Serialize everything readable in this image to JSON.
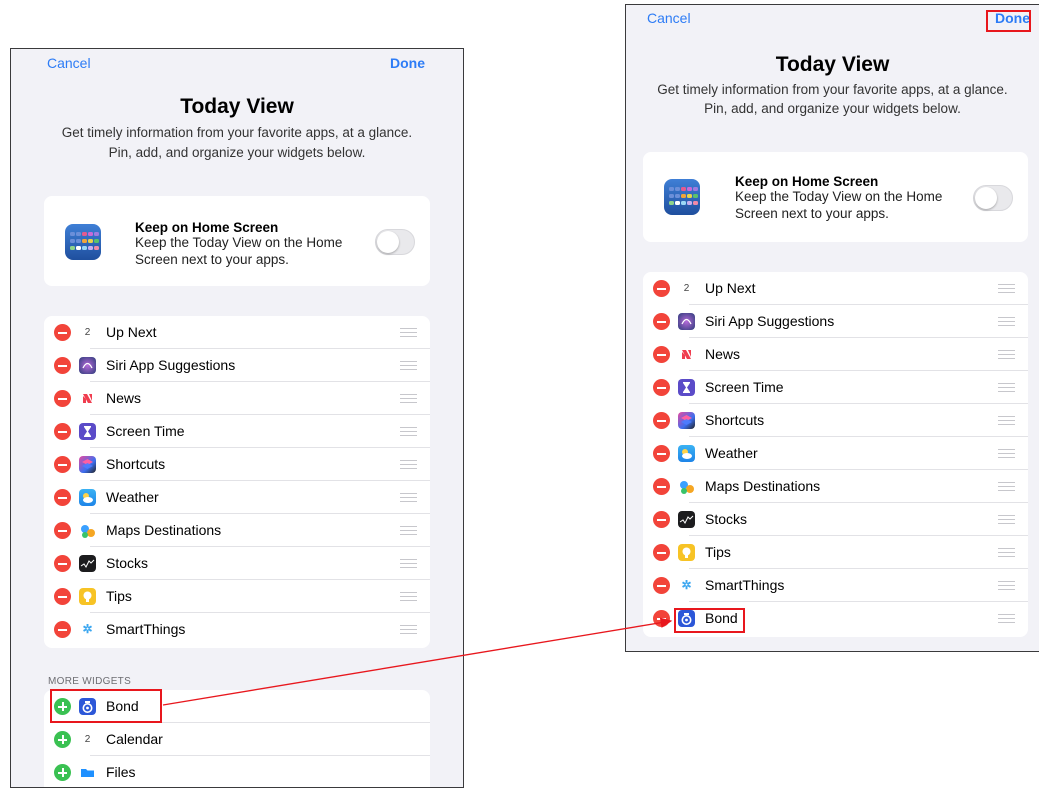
{
  "left": {
    "cancel": "Cancel",
    "done": "Done",
    "title": "Today View",
    "subtitle_line1": "Get timely information from your favorite apps, at a glance.",
    "subtitle_line2": "Pin, add, and organize your widgets below.",
    "keep_title": "Keep on Home Screen",
    "keep_desc_line1": "Keep the Today View on the Home",
    "keep_desc_line2": "Screen next to your apps.",
    "widgets": [
      {
        "label": "Up Next",
        "icon": "calendar-icon"
      },
      {
        "label": "Siri App Suggestions",
        "icon": "siri-icon"
      },
      {
        "label": "News",
        "icon": "news-icon"
      },
      {
        "label": "Screen Time",
        "icon": "hourglass-icon"
      },
      {
        "label": "Shortcuts",
        "icon": "shortcuts-icon"
      },
      {
        "label": "Weather",
        "icon": "weather-icon"
      },
      {
        "label": "Maps Destinations",
        "icon": "maps-icon"
      },
      {
        "label": "Stocks",
        "icon": "stocks-icon"
      },
      {
        "label": "Tips",
        "icon": "tips-icon"
      },
      {
        "label": "SmartThings",
        "icon": "smartthings-icon"
      }
    ],
    "more_header": "MORE WIDGETS",
    "more": [
      {
        "label": "Bond",
        "icon": "bond-icon"
      },
      {
        "label": "Calendar",
        "icon": "calendar-icon"
      },
      {
        "label": "Files",
        "icon": "folder-icon"
      }
    ]
  },
  "right": {
    "cancel": "Cancel",
    "done": "Done",
    "title": "Today View",
    "subtitle_line1": "Get timely information from your favorite apps, at a glance.",
    "subtitle_line2": "Pin, add, and organize your widgets below.",
    "keep_title": "Keep on Home Screen",
    "keep_desc_line1": "Keep the Today View on the Home",
    "keep_desc_line2": "Screen next to your apps.",
    "widgets": [
      {
        "label": "Up Next",
        "icon": "calendar-icon"
      },
      {
        "label": "Siri App Suggestions",
        "icon": "siri-icon"
      },
      {
        "label": "News",
        "icon": "news-icon"
      },
      {
        "label": "Screen Time",
        "icon": "hourglass-icon"
      },
      {
        "label": "Shortcuts",
        "icon": "shortcuts-icon"
      },
      {
        "label": "Weather",
        "icon": "weather-icon"
      },
      {
        "label": "Maps Destinations",
        "icon": "maps-icon"
      },
      {
        "label": "Stocks",
        "icon": "stocks-icon"
      },
      {
        "label": "Tips",
        "icon": "tips-icon"
      },
      {
        "label": "SmartThings",
        "icon": "smartthings-icon"
      },
      {
        "label": "Bond",
        "icon": "bond-icon"
      }
    ]
  },
  "calendar_day": "2",
  "colors": {
    "accent": "#2d7cf6",
    "remove": "#f2443a",
    "add": "#3ac152",
    "highlight": "#e8171d",
    "background": "#f2f2f7"
  }
}
